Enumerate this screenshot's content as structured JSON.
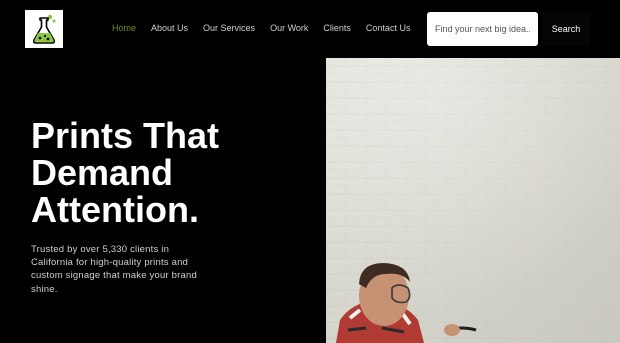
{
  "nav": {
    "items": [
      {
        "label": "Home",
        "active": true
      },
      {
        "label": "About Us"
      },
      {
        "label": "Our Services"
      },
      {
        "label": "Our Work"
      },
      {
        "label": "Clients"
      },
      {
        "label": "Contact Us"
      }
    ]
  },
  "search": {
    "placeholder": "Find your next big idea...",
    "button_label": "Search"
  },
  "hero": {
    "headline": "Prints That Demand Attention.",
    "subtext": "Trusted by over 5,330 clients in California for high-quality prints and custom signage that make your brand shine."
  },
  "colors": {
    "background": "#000000",
    "accent_active_nav": "#6e8b21",
    "logo_liquid": "#8dc63f"
  },
  "icons": {
    "logo": "flask-logo-icon"
  }
}
